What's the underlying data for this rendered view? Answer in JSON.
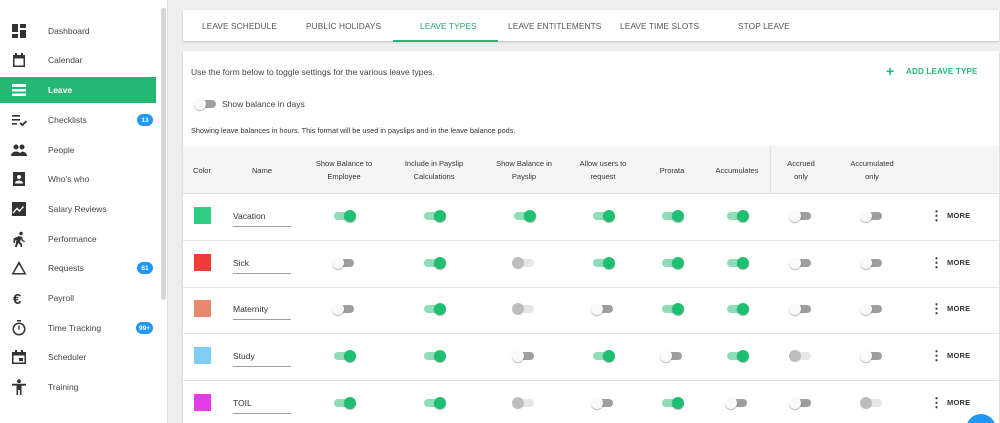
{
  "sidebar": {
    "items": [
      {
        "label": "Dashboard",
        "icon": "dashboard-icon",
        "active": false,
        "badge": ""
      },
      {
        "label": "Calendar",
        "icon": "calendar-icon",
        "active": false,
        "badge": ""
      },
      {
        "label": "Leave",
        "icon": "leave-icon",
        "active": true,
        "badge": ""
      },
      {
        "label": "Checklists",
        "icon": "checklist-icon",
        "active": false,
        "badge": "13"
      },
      {
        "label": "People",
        "icon": "people-icon",
        "active": false,
        "badge": ""
      },
      {
        "label": "Who's who",
        "icon": "contact-card-icon",
        "active": false,
        "badge": ""
      },
      {
        "label": "Salary Reviews",
        "icon": "trend-chart-icon",
        "active": false,
        "badge": ""
      },
      {
        "label": "Performance",
        "icon": "running-person-icon",
        "active": false,
        "badge": ""
      },
      {
        "label": "Requests",
        "icon": "warning-triangle-icon",
        "active": false,
        "badge": "61"
      },
      {
        "label": "Payroll",
        "icon": "euro-icon",
        "active": false,
        "badge": ""
      },
      {
        "label": "Time Tracking",
        "icon": "stopwatch-icon",
        "active": false,
        "badge": "99+"
      },
      {
        "label": "Scheduler",
        "icon": "scheduler-icon",
        "active": false,
        "badge": ""
      },
      {
        "label": "Training",
        "icon": "training-icon",
        "active": false,
        "badge": ""
      }
    ]
  },
  "tabs": [
    {
      "label": "LEAVE SCHEDULE",
      "active": false
    },
    {
      "label": "PUBLIC HOLIDAYS",
      "active": false
    },
    {
      "label": "LEAVE TYPES",
      "active": true
    },
    {
      "label": "LEAVE ENTITLEMENTS",
      "active": false
    },
    {
      "label": "LEAVE TIME SLOTS",
      "active": false
    },
    {
      "label": "STOP LEAVE",
      "active": false
    }
  ],
  "main": {
    "intro": "Use the form below to toggle settings for the various leave types.",
    "add_button": "ADD LEAVE TYPE",
    "show_days_label": "Show balance in days",
    "show_days_state": "off",
    "hours_note": "Showing leave balances in hours. This format will be used in payslips and in the leave balance pods.",
    "more_label": "MORE"
  },
  "table": {
    "headers": [
      {
        "line1": "Color",
        "line2": ""
      },
      {
        "line1": "Name",
        "line2": ""
      },
      {
        "line1": "Show Balance to",
        "line2": "Employee"
      },
      {
        "line1": "Include in Payslip",
        "line2": "Calculations"
      },
      {
        "line1": "Show Balance in",
        "line2": "Payslip"
      },
      {
        "line1": "Allow users to",
        "line2": "request"
      },
      {
        "line1": "Prorata",
        "line2": ""
      },
      {
        "line1": "Accumulates",
        "line2": ""
      },
      {
        "line1": "Accrued",
        "line2": "only"
      },
      {
        "line1": "Accumulated",
        "line2": "only"
      }
    ],
    "rows": [
      {
        "name": "Vacation",
        "color": "#2ecc85",
        "toggles": [
          "on",
          "on",
          "on",
          "on",
          "on",
          "on",
          "off",
          "off"
        ]
      },
      {
        "name": "Sick",
        "color": "#f03b3b",
        "toggles": [
          "off",
          "on",
          "disabled",
          "on",
          "on",
          "on",
          "off",
          "off"
        ]
      },
      {
        "name": "Maternity",
        "color": "#e8896f",
        "toggles": [
          "off",
          "on",
          "disabled",
          "off",
          "on",
          "on",
          "off",
          "off"
        ]
      },
      {
        "name": "Study",
        "color": "#7fcdf5",
        "toggles": [
          "on",
          "on",
          "off",
          "on",
          "off",
          "on",
          "disabled",
          "off"
        ]
      },
      {
        "name": "TOIL",
        "color": "#e63ce8",
        "toggles": [
          "on",
          "on",
          "disabled",
          "off",
          "on",
          "off",
          "off",
          "disabled"
        ]
      }
    ]
  },
  "colors": {
    "accent": "#25b874",
    "badge": "#2196f3"
  }
}
